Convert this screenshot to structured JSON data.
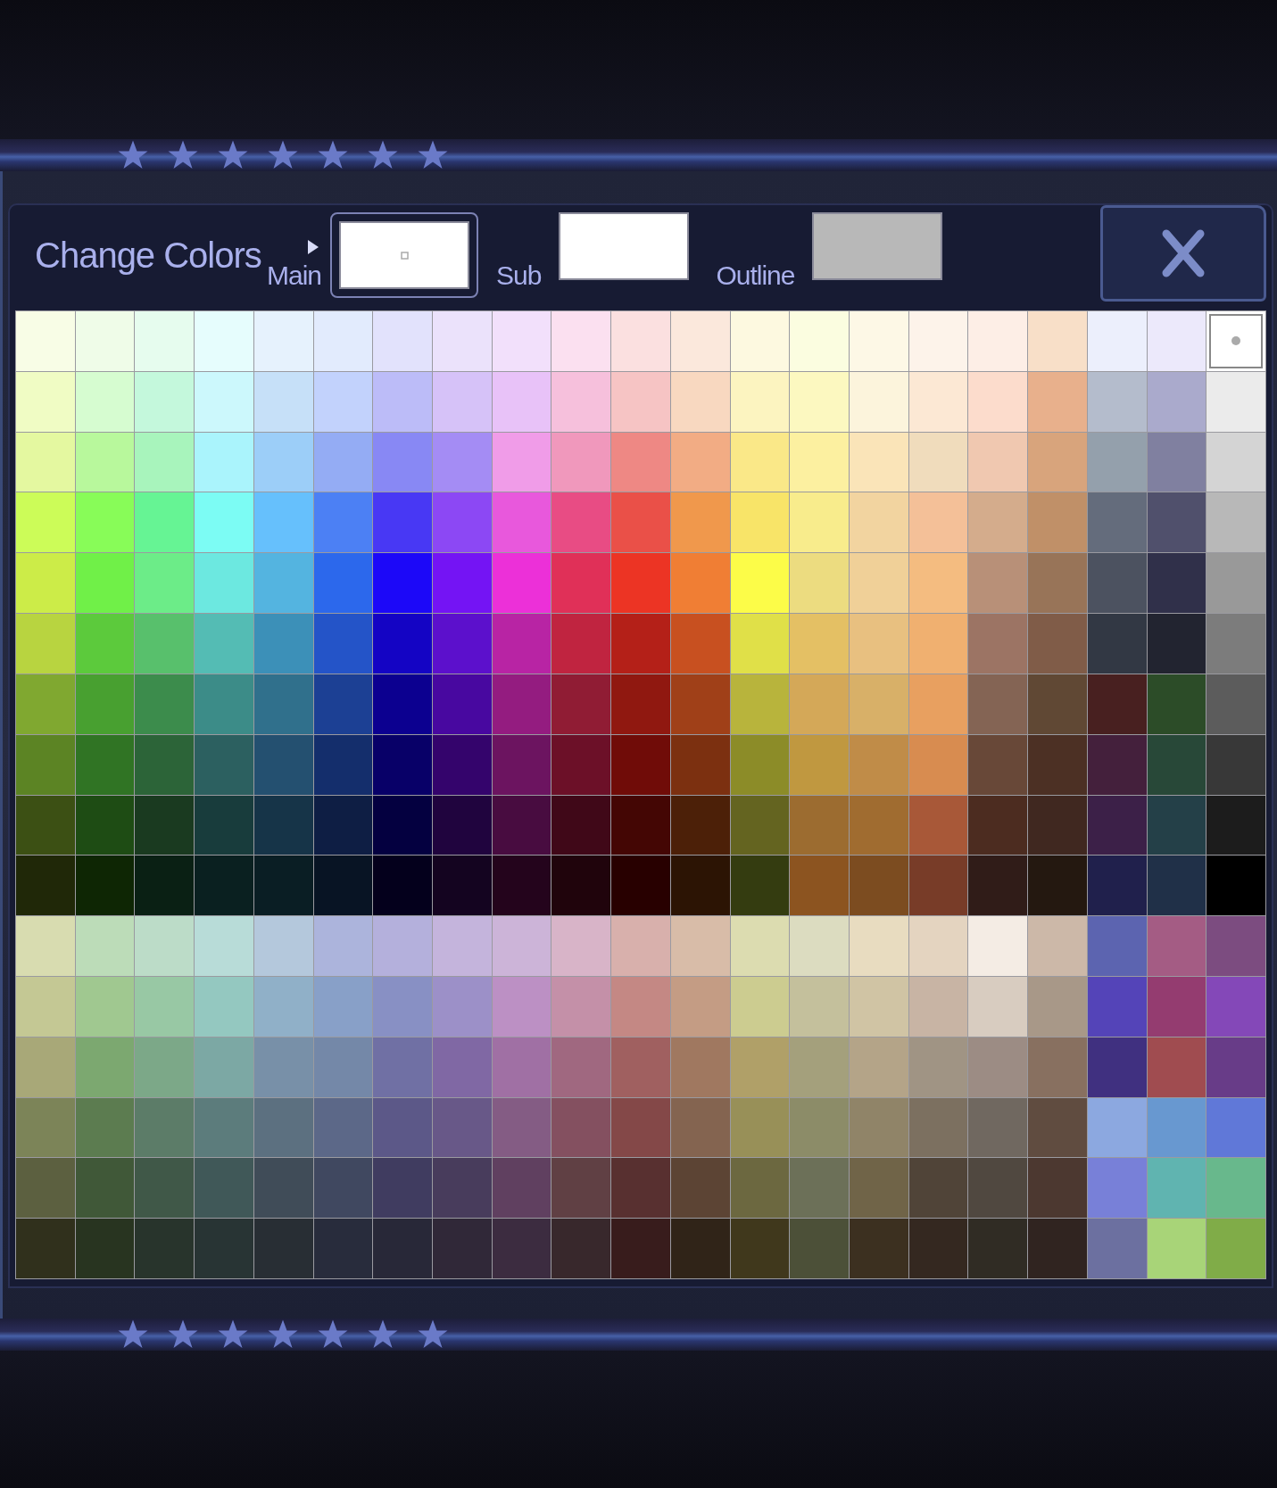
{
  "dialog": {
    "title": "Change Colors",
    "slots": [
      {
        "label": "Main",
        "color": "#ffffff",
        "selected": true
      },
      {
        "label": "Sub",
        "color": "#ffffff",
        "selected": false
      },
      {
        "label": "Outline",
        "color": "#b8b8b8",
        "selected": false
      }
    ]
  },
  "palette": [
    {
      "swatches": [
        {
          "color": "#f8fde6",
          "selected": false
        },
        {
          "color": "#effce8",
          "selected": false
        },
        {
          "color": "#e6fcee",
          "selected": false
        },
        {
          "color": "#e6fdfd",
          "selected": false
        },
        {
          "color": "#e6f2fd",
          "selected": false
        },
        {
          "color": "#e2ebfd",
          "selected": false
        },
        {
          "color": "#e2e2fc",
          "selected": false
        },
        {
          "color": "#ebe2fb",
          "selected": false
        },
        {
          "color": "#f2e0fb",
          "selected": false
        },
        {
          "color": "#fbe0f0",
          "selected": false
        },
        {
          "color": "#fbe0e0",
          "selected": false
        },
        {
          "color": "#fbe8dc",
          "selected": false
        },
        {
          "color": "#fdf9e0",
          "selected": false
        },
        {
          "color": "#fbfde0",
          "selected": false
        },
        {
          "color": "#fdf8e6",
          "selected": false
        },
        {
          "color": "#fdf3ea",
          "selected": false
        },
        {
          "color": "#fdeee6",
          "selected": false
        },
        {
          "color": "#f8dfc8",
          "selected": false
        },
        {
          "color": "#eceffc",
          "selected": false
        },
        {
          "color": "#ece9fb",
          "selected": false
        },
        {
          "color": "#ffffff",
          "selected": true
        }
      ]
    },
    {
      "swatches": [
        {
          "color": "#f0fcc4",
          "selected": false
        },
        {
          "color": "#d6fcd0",
          "selected": false
        },
        {
          "color": "#c4f8dc",
          "selected": false
        },
        {
          "color": "#ccf8fc",
          "selected": false
        },
        {
          "color": "#c6e0f8",
          "selected": false
        },
        {
          "color": "#c2d2fc",
          "selected": false
        },
        {
          "color": "#bcbcf8",
          "selected": false
        },
        {
          "color": "#d6c2f8",
          "selected": false
        },
        {
          "color": "#e8c2f8",
          "selected": false
        },
        {
          "color": "#f6c0dc",
          "selected": false
        },
        {
          "color": "#f6c4c4",
          "selected": false
        },
        {
          "color": "#f8d8c0",
          "selected": false
        },
        {
          "color": "#fcf4c0",
          "selected": false
        },
        {
          "color": "#fcf8c0",
          "selected": false
        },
        {
          "color": "#fcf4dc",
          "selected": false
        },
        {
          "color": "#fce8d4",
          "selected": false
        },
        {
          "color": "#fcdccc",
          "selected": false
        },
        {
          "color": "#e8b08c",
          "selected": false
        },
        {
          "color": "#b4bccc",
          "selected": false
        },
        {
          "color": "#aaaacc",
          "selected": false
        },
        {
          "color": "#ebebeb",
          "selected": false
        }
      ]
    },
    {
      "swatches": [
        {
          "color": "#e4f8a0",
          "selected": false
        },
        {
          "color": "#b8f89c",
          "selected": false
        },
        {
          "color": "#a8f4bc",
          "selected": false
        },
        {
          "color": "#aaf4fc",
          "selected": false
        },
        {
          "color": "#9ccef8",
          "selected": false
        },
        {
          "color": "#94acf4",
          "selected": false
        },
        {
          "color": "#8888f4",
          "selected": false
        },
        {
          "color": "#a48cf4",
          "selected": false
        },
        {
          "color": "#f09ce8",
          "selected": false
        },
        {
          "color": "#f098bc",
          "selected": false
        },
        {
          "color": "#ee8884",
          "selected": false
        },
        {
          "color": "#f2ac84",
          "selected": false
        },
        {
          "color": "#fae888",
          "selected": false
        },
        {
          "color": "#fcf0a0",
          "selected": false
        },
        {
          "color": "#fae4b8",
          "selected": false
        },
        {
          "color": "#f0dcbc",
          "selected": false
        },
        {
          "color": "#f0c8b0",
          "selected": false
        },
        {
          "color": "#d8a47c",
          "selected": false
        },
        {
          "color": "#94a0ac",
          "selected": false
        },
        {
          "color": "#8080a0",
          "selected": false
        },
        {
          "color": "#d4d4d4",
          "selected": false
        }
      ]
    },
    {
      "swatches": [
        {
          "color": "#ccfc58",
          "selected": false
        },
        {
          "color": "#88fc58",
          "selected": false
        },
        {
          "color": "#66f494",
          "selected": false
        },
        {
          "color": "#7cfcf4",
          "selected": false
        },
        {
          "color": "#66c0fc",
          "selected": false
        },
        {
          "color": "#4c80f4",
          "selected": false
        },
        {
          "color": "#4838f4",
          "selected": false
        },
        {
          "color": "#8c48f4",
          "selected": false
        },
        {
          "color": "#e858dc",
          "selected": false
        },
        {
          "color": "#e84c84",
          "selected": false
        },
        {
          "color": "#ea5048",
          "selected": false
        },
        {
          "color": "#f0984c",
          "selected": false
        },
        {
          "color": "#f8e468",
          "selected": false
        },
        {
          "color": "#f8ec8c",
          "selected": false
        },
        {
          "color": "#f2d4a0",
          "selected": false
        },
        {
          "color": "#f4c098",
          "selected": false
        },
        {
          "color": "#d4ac8c",
          "selected": false
        },
        {
          "color": "#c09068",
          "selected": false
        },
        {
          "color": "#646c7c",
          "selected": false
        },
        {
          "color": "#50506c",
          "selected": false
        },
        {
          "color": "#b8b8b8",
          "selected": false
        }
      ]
    },
    {
      "swatches": [
        {
          "color": "#ccec48",
          "selected": false
        },
        {
          "color": "#70f048",
          "selected": false
        },
        {
          "color": "#6cec88",
          "selected": false
        },
        {
          "color": "#6ce8e0",
          "selected": false
        },
        {
          "color": "#54b4e0",
          "selected": false
        },
        {
          "color": "#2c68ec",
          "selected": false
        },
        {
          "color": "#1c08f8",
          "selected": false
        },
        {
          "color": "#7414f4",
          "selected": false
        },
        {
          "color": "#ec30d8",
          "selected": false
        },
        {
          "color": "#e03058",
          "selected": false
        },
        {
          "color": "#ec3424",
          "selected": false
        },
        {
          "color": "#f07e34",
          "selected": false
        },
        {
          "color": "#fcfc48",
          "selected": false
        },
        {
          "color": "#ecdc80",
          "selected": false
        },
        {
          "color": "#f0d098",
          "selected": false
        },
        {
          "color": "#f4bc80",
          "selected": false
        },
        {
          "color": "#b89078",
          "selected": false
        },
        {
          "color": "#987458",
          "selected": false
        },
        {
          "color": "#4c5260",
          "selected": false
        },
        {
          "color": "#30304a",
          "selected": false
        },
        {
          "color": "#999999",
          "selected": false
        }
      ]
    },
    {
      "swatches": [
        {
          "color": "#b8d440",
          "selected": false
        },
        {
          "color": "#5cca3c",
          "selected": false
        },
        {
          "color": "#58c06c",
          "selected": false
        },
        {
          "color": "#54bcb4",
          "selected": false
        },
        {
          "color": "#3c90b8",
          "selected": false
        },
        {
          "color": "#2454c8",
          "selected": false
        },
        {
          "color": "#1404c4",
          "selected": false
        },
        {
          "color": "#5c10cc",
          "selected": false
        },
        {
          "color": "#b824a4",
          "selected": false
        },
        {
          "color": "#c02440",
          "selected": false
        },
        {
          "color": "#b42018",
          "selected": false
        },
        {
          "color": "#c85020",
          "selected": false
        },
        {
          "color": "#e0e048",
          "selected": false
        },
        {
          "color": "#e4c064",
          "selected": false
        },
        {
          "color": "#e8c080",
          "selected": false
        },
        {
          "color": "#f0b070",
          "selected": false
        },
        {
          "color": "#9c7464",
          "selected": false
        },
        {
          "color": "#805c48",
          "selected": false
        },
        {
          "color": "#323844",
          "selected": false
        },
        {
          "color": "#222430",
          "selected": false
        },
        {
          "color": "#7c7c7c",
          "selected": false
        }
      ]
    },
    {
      "swatches": [
        {
          "color": "#80a830",
          "selected": false
        },
        {
          "color": "#48a030",
          "selected": false
        },
        {
          "color": "#3c8c4c",
          "selected": false
        },
        {
          "color": "#3c8c88",
          "selected": false
        },
        {
          "color": "#30708c",
          "selected": false
        },
        {
          "color": "#1c4094",
          "selected": false
        },
        {
          "color": "#0c0090",
          "selected": false
        },
        {
          "color": "#4808a0",
          "selected": false
        },
        {
          "color": "#941c80",
          "selected": false
        },
        {
          "color": "#901c34",
          "selected": false
        },
        {
          "color": "#901810",
          "selected": false
        },
        {
          "color": "#a04018",
          "selected": false
        },
        {
          "color": "#b8b43c",
          "selected": false
        },
        {
          "color": "#d4a858",
          "selected": false
        },
        {
          "color": "#d8b068",
          "selected": false
        },
        {
          "color": "#e8a060",
          "selected": false
        },
        {
          "color": "#846454",
          "selected": false
        },
        {
          "color": "#604834",
          "selected": false
        },
        {
          "color": "#482020",
          "selected": false
        },
        {
          "color": "#2c4c28",
          "selected": false
        },
        {
          "color": "#5c5c5c",
          "selected": false
        }
      ]
    },
    {
      "swatches": [
        {
          "color": "#5c8424",
          "selected": false
        },
        {
          "color": "#307424",
          "selected": false
        },
        {
          "color": "#2c6438",
          "selected": false
        },
        {
          "color": "#2c6060",
          "selected": false
        },
        {
          "color": "#245070",
          "selected": false
        },
        {
          "color": "#142e6c",
          "selected": false
        },
        {
          "color": "#080068",
          "selected": false
        },
        {
          "color": "#34046c",
          "selected": false
        },
        {
          "color": "#6c1460",
          "selected": false
        },
        {
          "color": "#6c1028",
          "selected": false
        },
        {
          "color": "#700c08",
          "selected": false
        },
        {
          "color": "#7c3010",
          "selected": false
        },
        {
          "color": "#8c8c28",
          "selected": false
        },
        {
          "color": "#c09840",
          "selected": false
        },
        {
          "color": "#c08c48",
          "selected": false
        },
        {
          "color": "#d88c50",
          "selected": false
        },
        {
          "color": "#684838",
          "selected": false
        },
        {
          "color": "#4c3024",
          "selected": false
        },
        {
          "color": "#44203c",
          "selected": false
        },
        {
          "color": "#284838",
          "selected": false
        },
        {
          "color": "#383838",
          "selected": false
        }
      ]
    },
    {
      "swatches": [
        {
          "color": "#3c5014",
          "selected": false
        },
        {
          "color": "#1e4c14",
          "selected": false
        },
        {
          "color": "#1a3a20",
          "selected": false
        },
        {
          "color": "#183c3c",
          "selected": false
        },
        {
          "color": "#163448",
          "selected": false
        },
        {
          "color": "#0e1e44",
          "selected": false
        },
        {
          "color": "#040040",
          "selected": false
        },
        {
          "color": "#20043e",
          "selected": false
        },
        {
          "color": "#480c40",
          "selected": false
        },
        {
          "color": "#400818",
          "selected": false
        },
        {
          "color": "#440604",
          "selected": false
        },
        {
          "color": "#4c2008",
          "selected": false
        },
        {
          "color": "#646420",
          "selected": false
        },
        {
          "color": "#9c6c30",
          "selected": false
        },
        {
          "color": "#a06c30",
          "selected": false
        },
        {
          "color": "#a85838",
          "selected": false
        },
        {
          "color": "#4c2c20",
          "selected": false
        },
        {
          "color": "#402820",
          "selected": false
        },
        {
          "color": "#3c2048",
          "selected": false
        },
        {
          "color": "#244048",
          "selected": false
        },
        {
          "color": "#1c1c1c",
          "selected": false
        }
      ]
    },
    {
      "swatches": [
        {
          "color": "#202808",
          "selected": false
        },
        {
          "color": "#0e2604",
          "selected": false
        },
        {
          "color": "#0a2014",
          "selected": false
        },
        {
          "color": "#0a2020",
          "selected": false
        },
        {
          "color": "#0a1e24",
          "selected": false
        },
        {
          "color": "#081424",
          "selected": false
        },
        {
          "color": "#04001c",
          "selected": false
        },
        {
          "color": "#140420",
          "selected": false
        },
        {
          "color": "#24041c",
          "selected": false
        },
        {
          "color": "#20040c",
          "selected": false
        },
        {
          "color": "#280000",
          "selected": false
        },
        {
          "color": "#2c1404",
          "selected": false
        },
        {
          "color": "#343c10",
          "selected": false
        },
        {
          "color": "#8c5420",
          "selected": false
        },
        {
          "color": "#7c4c20",
          "selected": false
        },
        {
          "color": "#783c28",
          "selected": false
        },
        {
          "color": "#301c18",
          "selected": false
        },
        {
          "color": "#241810",
          "selected": false
        },
        {
          "color": "#20204c",
          "selected": false
        },
        {
          "color": "#203048",
          "selected": false
        },
        {
          "color": "#000000",
          "selected": false
        }
      ]
    },
    {
      "swatches": [
        {
          "color": "#d8dcb0",
          "selected": false
        },
        {
          "color": "#bcdcb8",
          "selected": false
        },
        {
          "color": "#bcdcc8",
          "selected": false
        },
        {
          "color": "#b8dcd8",
          "selected": false
        },
        {
          "color": "#b4c8dc",
          "selected": false
        },
        {
          "color": "#acb4dc",
          "selected": false
        },
        {
          "color": "#b4b0dc",
          "selected": false
        },
        {
          "color": "#c4b4dc",
          "selected": false
        },
        {
          "color": "#ccb4d8",
          "selected": false
        },
        {
          "color": "#d8b4c8",
          "selected": false
        },
        {
          "color": "#d8b0ac",
          "selected": false
        },
        {
          "color": "#d8bca8",
          "selected": false
        },
        {
          "color": "#dcdcb0",
          "selected": false
        },
        {
          "color": "#dcdcc0",
          "selected": false
        },
        {
          "color": "#e8dcc0",
          "selected": false
        },
        {
          "color": "#e4d4c0",
          "selected": false
        },
        {
          "color": "#f4ece4",
          "selected": false
        },
        {
          "color": "#ccb8a8",
          "selected": false
        },
        {
          "color": "#5c64b0",
          "selected": false
        },
        {
          "color": "#a45c84",
          "selected": false
        },
        {
          "color": "#7c4c80",
          "selected": false
        }
      ]
    },
    {
      "swatches": [
        {
          "color": "#c4c894",
          "selected": false
        },
        {
          "color": "#a0c890",
          "selected": false
        },
        {
          "color": "#98c8a4",
          "selected": false
        },
        {
          "color": "#94c8c0",
          "selected": false
        },
        {
          "color": "#90b0c8",
          "selected": false
        },
        {
          "color": "#88a0c8",
          "selected": false
        },
        {
          "color": "#8890c4",
          "selected": false
        },
        {
          "color": "#9c90c8",
          "selected": false
        },
        {
          "color": "#bc90c4",
          "selected": false
        },
        {
          "color": "#c490a8",
          "selected": false
        },
        {
          "color": "#c48884",
          "selected": false
        },
        {
          "color": "#c49c84",
          "selected": false
        },
        {
          "color": "#cccc90",
          "selected": false
        },
        {
          "color": "#c4c09c",
          "selected": false
        },
        {
          "color": "#d0c4a4",
          "selected": false
        },
        {
          "color": "#c8b4a4",
          "selected": false
        },
        {
          "color": "#d8ccc0",
          "selected": false
        },
        {
          "color": "#a89888",
          "selected": false
        },
        {
          "color": "#5444b8",
          "selected": false
        },
        {
          "color": "#943c70",
          "selected": false
        },
        {
          "color": "#8448b8",
          "selected": false
        }
      ]
    },
    {
      "swatches": [
        {
          "color": "#a8a878",
          "selected": false
        },
        {
          "color": "#7ca870",
          "selected": false
        },
        {
          "color": "#7ca888",
          "selected": false
        },
        {
          "color": "#7ca8a4",
          "selected": false
        },
        {
          "color": "#7890a8",
          "selected": false
        },
        {
          "color": "#7488a8",
          "selected": false
        },
        {
          "color": "#7070a4",
          "selected": false
        },
        {
          "color": "#8068a4",
          "selected": false
        },
        {
          "color": "#a070a4",
          "selected": false
        },
        {
          "color": "#a06880",
          "selected": false
        },
        {
          "color": "#a06060",
          "selected": false
        },
        {
          "color": "#a07860",
          "selected": false
        },
        {
          "color": "#b0a068",
          "selected": false
        },
        {
          "color": "#a4a07c",
          "selected": false
        },
        {
          "color": "#b4a488",
          "selected": false
        },
        {
          "color": "#a09484",
          "selected": false
        },
        {
          "color": "#9c8c84",
          "selected": false
        },
        {
          "color": "#887060",
          "selected": false
        },
        {
          "color": "#403080",
          "selected": false
        },
        {
          "color": "#a04c50",
          "selected": false
        },
        {
          "color": "#683c88",
          "selected": false
        }
      ]
    },
    {
      "swatches": [
        {
          "color": "#7c8458",
          "selected": false
        },
        {
          "color": "#5c7c50",
          "selected": false
        },
        {
          "color": "#5c7c68",
          "selected": false
        },
        {
          "color": "#5c7c7c",
          "selected": false
        },
        {
          "color": "#5c7080",
          "selected": false
        },
        {
          "color": "#5c6888",
          "selected": false
        },
        {
          "color": "#5c5888",
          "selected": false
        },
        {
          "color": "#685888",
          "selected": false
        },
        {
          "color": "#845c84",
          "selected": false
        },
        {
          "color": "#845060",
          "selected": false
        },
        {
          "color": "#844848",
          "selected": false
        },
        {
          "color": "#846450",
          "selected": false
        },
        {
          "color": "#989058",
          "selected": false
        },
        {
          "color": "#8c8c68",
          "selected": false
        },
        {
          "color": "#908468",
          "selected": false
        },
        {
          "color": "#7c7060",
          "selected": false
        },
        {
          "color": "#706860",
          "selected": false
        },
        {
          "color": "#604c40",
          "selected": false
        },
        {
          "color": "#8ca8e0",
          "selected": false
        },
        {
          "color": "#6898d0",
          "selected": false
        },
        {
          "color": "#6078d8",
          "selected": false
        }
      ]
    },
    {
      "swatches": [
        {
          "color": "#5c6040",
          "selected": false
        },
        {
          "color": "#405838",
          "selected": false
        },
        {
          "color": "#405848",
          "selected": false
        },
        {
          "color": "#405858",
          "selected": false
        },
        {
          "color": "#404c58",
          "selected": false
        },
        {
          "color": "#404860",
          "selected": false
        },
        {
          "color": "#403c60",
          "selected": false
        },
        {
          "color": "#483c5c",
          "selected": false
        },
        {
          "color": "#604060",
          "selected": false
        },
        {
          "color": "#604044",
          "selected": false
        },
        {
          "color": "#583030",
          "selected": false
        },
        {
          "color": "#5c4434",
          "selected": false
        },
        {
          "color": "#6c6840",
          "selected": false
        },
        {
          "color": "#6c7058",
          "selected": false
        },
        {
          "color": "#706448",
          "selected": false
        },
        {
          "color": "#504438",
          "selected": false
        },
        {
          "color": "#504840",
          "selected": false
        },
        {
          "color": "#4c3830",
          "selected": false
        },
        {
          "color": "#7880d8",
          "selected": false
        },
        {
          "color": "#60b4b0",
          "selected": false
        },
        {
          "color": "#68b88c",
          "selected": false
        }
      ]
    },
    {
      "swatches": [
        {
          "color": "#30301c",
          "selected": false
        },
        {
          "color": "#283420",
          "selected": false
        },
        {
          "color": "#28342c",
          "selected": false
        },
        {
          "color": "#283434",
          "selected": false
        },
        {
          "color": "#282e34",
          "selected": false
        },
        {
          "color": "#282c3c",
          "selected": false
        },
        {
          "color": "#282838",
          "selected": false
        },
        {
          "color": "#302838",
          "selected": false
        },
        {
          "color": "#3c2c40",
          "selected": false
        },
        {
          "color": "#38282c",
          "selected": false
        },
        {
          "color": "#381c1c",
          "selected": false
        },
        {
          "color": "#302418",
          "selected": false
        },
        {
          "color": "#40381c",
          "selected": false
        },
        {
          "color": "#4c5038",
          "selected": false
        },
        {
          "color": "#3c3020",
          "selected": false
        },
        {
          "color": "#342820",
          "selected": false
        },
        {
          "color": "#302c24",
          "selected": false
        },
        {
          "color": "#302420",
          "selected": false
        },
        {
          "color": "#6c70a0",
          "selected": false
        },
        {
          "color": "#a8d478",
          "selected": false
        },
        {
          "color": "#80ac48",
          "selected": false
        }
      ]
    }
  ]
}
